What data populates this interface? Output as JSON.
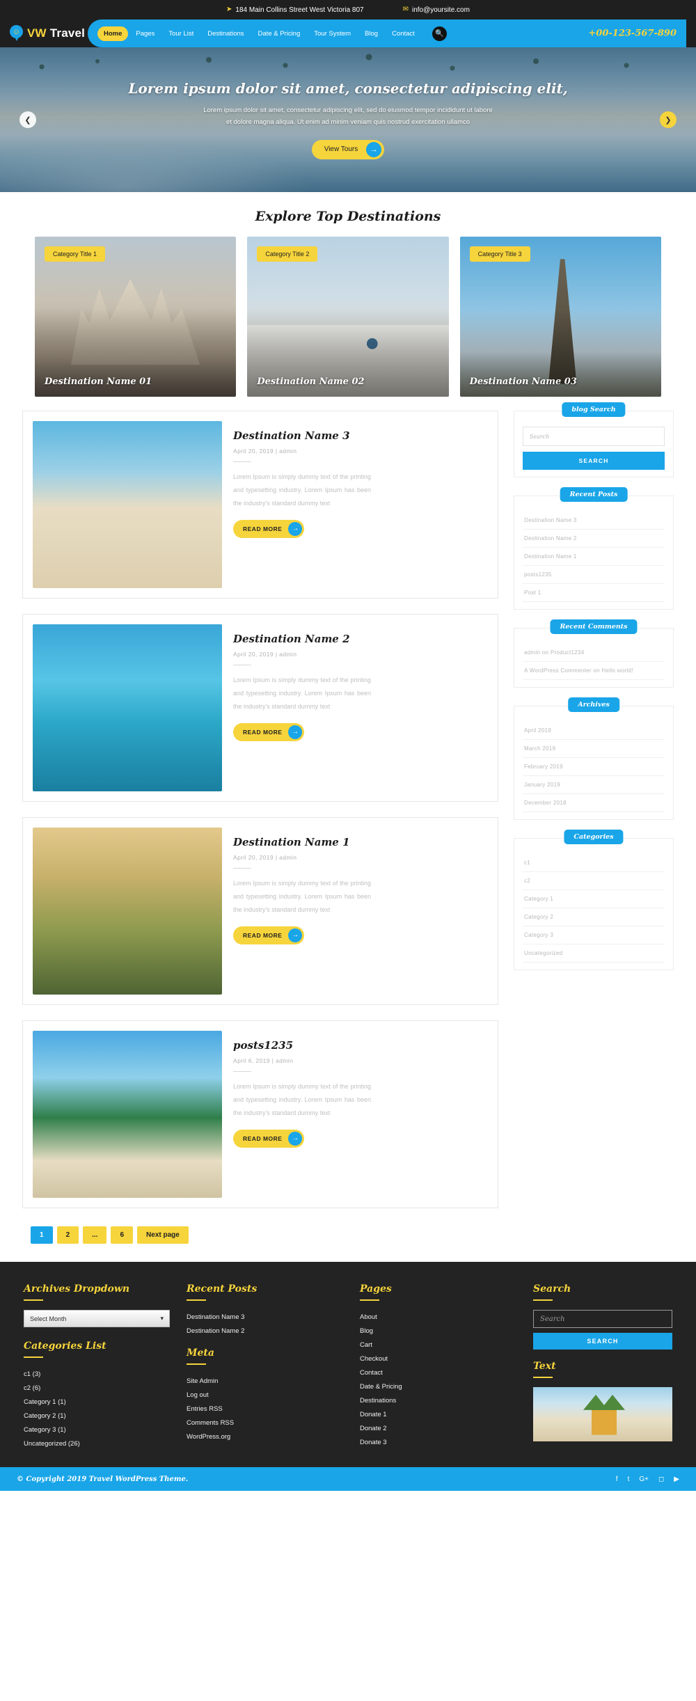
{
  "topbar": {
    "address": "184 Main Collins Street West Victoria 807",
    "email": "info@yoursite.com",
    "location_icon": "location-arrow-icon",
    "mail_icon": "envelope-icon"
  },
  "header": {
    "brand_prefix": "VW",
    "brand_suffix": "Travel",
    "logo_icon": "map-pin-smiley-icon",
    "phone": "+00-123-567-890",
    "search_icon": "search-icon",
    "nav": [
      {
        "label": "Home",
        "active": true
      },
      {
        "label": "Pages",
        "active": false
      },
      {
        "label": "Tour List",
        "active": false
      },
      {
        "label": "Destinations",
        "active": false
      },
      {
        "label": "Date & Pricing",
        "active": false
      },
      {
        "label": "Tour System",
        "active": false
      },
      {
        "label": "Blog",
        "active": false
      },
      {
        "label": "Contact",
        "active": false
      }
    ]
  },
  "hero": {
    "title": "Lorem ipsum dolor sit amet, consectetur adipiscing elit,",
    "subtitle": "Lorem ipsum dolor sit amet, consectetur adipiscing elit, sed do eiusmod tempor incididunt ut labore et dolore magna aliqua. Ut enim ad minim veniam quis nostrud exercitation ullamco",
    "cta_label": "View Tours",
    "prev_icon": "chevron-left-icon",
    "next_icon": "chevron-right-icon",
    "arrow_icon": "arrow-right-icon"
  },
  "explore": {
    "title": "Explore Top Destinations",
    "cards": [
      {
        "tag": "Category Title 1",
        "name": "Destination Name 01"
      },
      {
        "tag": "Category Title 2",
        "name": "Destination Name 02"
      },
      {
        "tag": "Category Title 3",
        "name": "Destination Name 03"
      }
    ]
  },
  "posts": [
    {
      "title": "Destination Name 3",
      "meta": "April 20, 2019 |  admin",
      "excerpt": "Lorem Ipsum is simply dummy text of the printing and typesetting industry. Lorem Ipsum has been the industry's standard dummy text",
      "read_more": "READ MORE"
    },
    {
      "title": "Destination Name 2",
      "meta": "April 20, 2019 |  admin",
      "excerpt": "Lorem Ipsum is simply dummy text of the printing and typesetting industry. Lorem Ipsum has been the industry's standard dummy text",
      "read_more": "READ MORE"
    },
    {
      "title": "Destination Name 1",
      "meta": "April 20, 2019 |  admin",
      "excerpt": "Lorem Ipsum is simply dummy text of the printing and typesetting industry. Lorem Ipsum has been the industry's standard dummy text",
      "read_more": "READ MORE"
    },
    {
      "title": "posts1235",
      "meta": "April 6, 2019 |  admin",
      "excerpt": "Lorem Ipsum is simply dummy text of the printing and typesetting industry. Lorem Ipsum has been the industry's standard dummy text",
      "read_more": "READ MORE"
    }
  ],
  "pagination": [
    {
      "label": "1",
      "active": true
    },
    {
      "label": "2",
      "active": false
    },
    {
      "label": "...",
      "active": false
    },
    {
      "label": "6",
      "active": false
    },
    {
      "label": "Next page",
      "active": false
    }
  ],
  "sidebar": {
    "search": {
      "title": "blog Search",
      "placeholder": "Search",
      "button": "SEARCH"
    },
    "recent_posts": {
      "title": "Recent Posts",
      "items": [
        "Destination Name 3",
        "Destination Name 2",
        "Destination Name 1",
        "posts1235",
        "Post 1"
      ]
    },
    "recent_comments": {
      "title": "Recent Comments",
      "items": [
        "admin on Product1234",
        "A WordPress Commenter on Hello world!"
      ]
    },
    "archives": {
      "title": "Archives",
      "items": [
        "April 2019",
        "March 2019",
        "February 2019",
        "January 2019",
        "December 2018"
      ]
    },
    "categories": {
      "title": "Categories",
      "items": [
        "c1",
        "c2",
        "Category 1",
        "Category 2",
        "Category 3",
        "Uncategorized"
      ]
    }
  },
  "footer": {
    "archives_dropdown": {
      "title": "Archives Dropdown",
      "selected": "Select Month",
      "chevron_icon": "chevron-down-icon"
    },
    "categories_list": {
      "title": "Categories List",
      "items": [
        "c1 (3)",
        "c2 (6)",
        "Category 1 (1)",
        "Category 2 (1)",
        "Category 3 (1)",
        "Uncategorized (26)"
      ]
    },
    "recent_posts": {
      "title": "Recent Posts",
      "items": [
        "Destination Name 3",
        "Destination Name 2"
      ]
    },
    "meta": {
      "title": "Meta",
      "items": [
        "Site Admin",
        "Log out",
        "Entries RSS",
        "Comments RSS",
        "WordPress.org"
      ]
    },
    "pages": {
      "title": "Pages",
      "items": [
        "About",
        "Blog",
        "Cart",
        "Checkout",
        "Contact",
        "Date & Pricing",
        "Destinations",
        "Donate 1",
        "Donate 2",
        "Donate 3"
      ]
    },
    "search": {
      "title": "Search",
      "placeholder": "Search",
      "button": "SEARCH"
    },
    "text_widget": {
      "title": "Text"
    },
    "copyright": "© Copyright 2019 Travel WordPress Theme.",
    "socials": [
      {
        "name": "facebook-icon",
        "glyph": "f"
      },
      {
        "name": "twitter-icon",
        "glyph": "t"
      },
      {
        "name": "google-plus-icon",
        "glyph": "G+"
      },
      {
        "name": "instagram-icon",
        "glyph": "◻"
      },
      {
        "name": "youtube-icon",
        "glyph": "▶"
      }
    ]
  }
}
